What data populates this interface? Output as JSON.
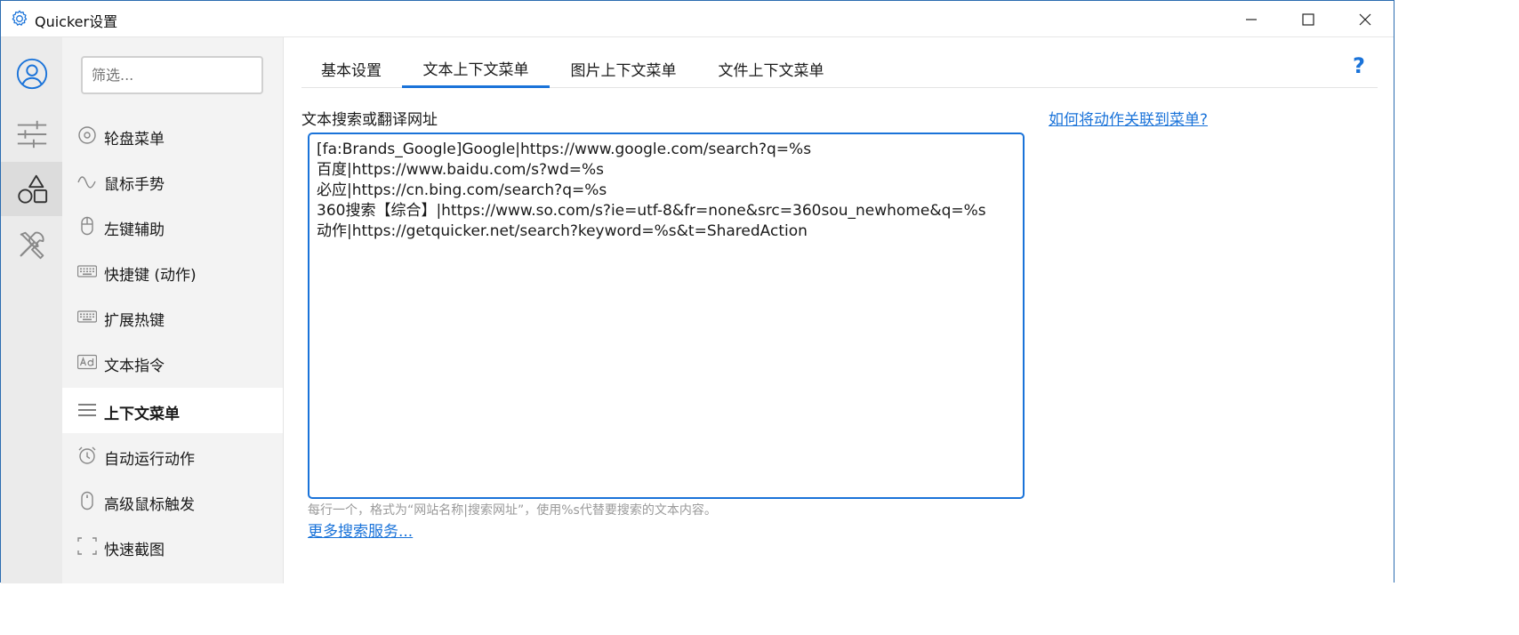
{
  "window": {
    "title": "Quicker设置",
    "accent_color": "#1a73d9",
    "controls": [
      "minimize-icon",
      "maximize-icon",
      "close-icon"
    ]
  },
  "rail": {
    "items": [
      {
        "icon": "user-circle-icon",
        "active": false
      },
      {
        "icon": "sliders-icon",
        "active": false
      },
      {
        "icon": "shapes-icon",
        "active": true
      },
      {
        "icon": "tools-icon",
        "active": false
      }
    ]
  },
  "menu": {
    "filter_placeholder": "筛选...",
    "items": [
      {
        "label": "轮盘菜单",
        "icon": "wheel-icon"
      },
      {
        "label": "鼠标手势",
        "icon": "gesture-wave-icon"
      },
      {
        "label": "左键辅助",
        "icon": "mouse-icon"
      },
      {
        "label": "快捷键 (动作)",
        "icon": "keyboard-icon"
      },
      {
        "label": "扩展热键",
        "icon": "keyboard-icon"
      },
      {
        "label": "文本指令",
        "icon": "ad-text-icon"
      },
      {
        "label": "上下文菜单",
        "icon": "menu-lines-icon",
        "active": true
      },
      {
        "label": "自动运行动作",
        "icon": "alarm-clock-icon"
      },
      {
        "label": "高级鼠标触发",
        "icon": "mouse-icon"
      },
      {
        "label": "快速截图",
        "icon": "screenshot-frame-icon"
      }
    ]
  },
  "tabs": [
    {
      "label": "基本设置"
    },
    {
      "label": "文本上下文菜单",
      "active": true
    },
    {
      "label": "图片上下文菜单"
    },
    {
      "label": "文件上下文菜单"
    }
  ],
  "help_label": "?",
  "content": {
    "field_label": "文本搜索或翻译网址",
    "link_top": "如何将动作关联到菜单?",
    "textarea_lines": [
      "[fa:Brands_Google]Google|https://www.google.com/search?q=%s",
      "百度|https://www.baidu.com/s?wd=%s",
      "必应|https://cn.bing.com/search?q=%s",
      "360搜索【综合】|https://www.so.com/s?ie=utf-8&fr=none&src=360sou_newhome&q=%s",
      "动作|https://getquicker.net/search?keyword=%s&t=SharedAction"
    ],
    "hint": "每行一个，格式为“网站名称|搜索网址”，使用%s代替要搜索的文本内容。",
    "link_more": "更多搜索服务..."
  }
}
